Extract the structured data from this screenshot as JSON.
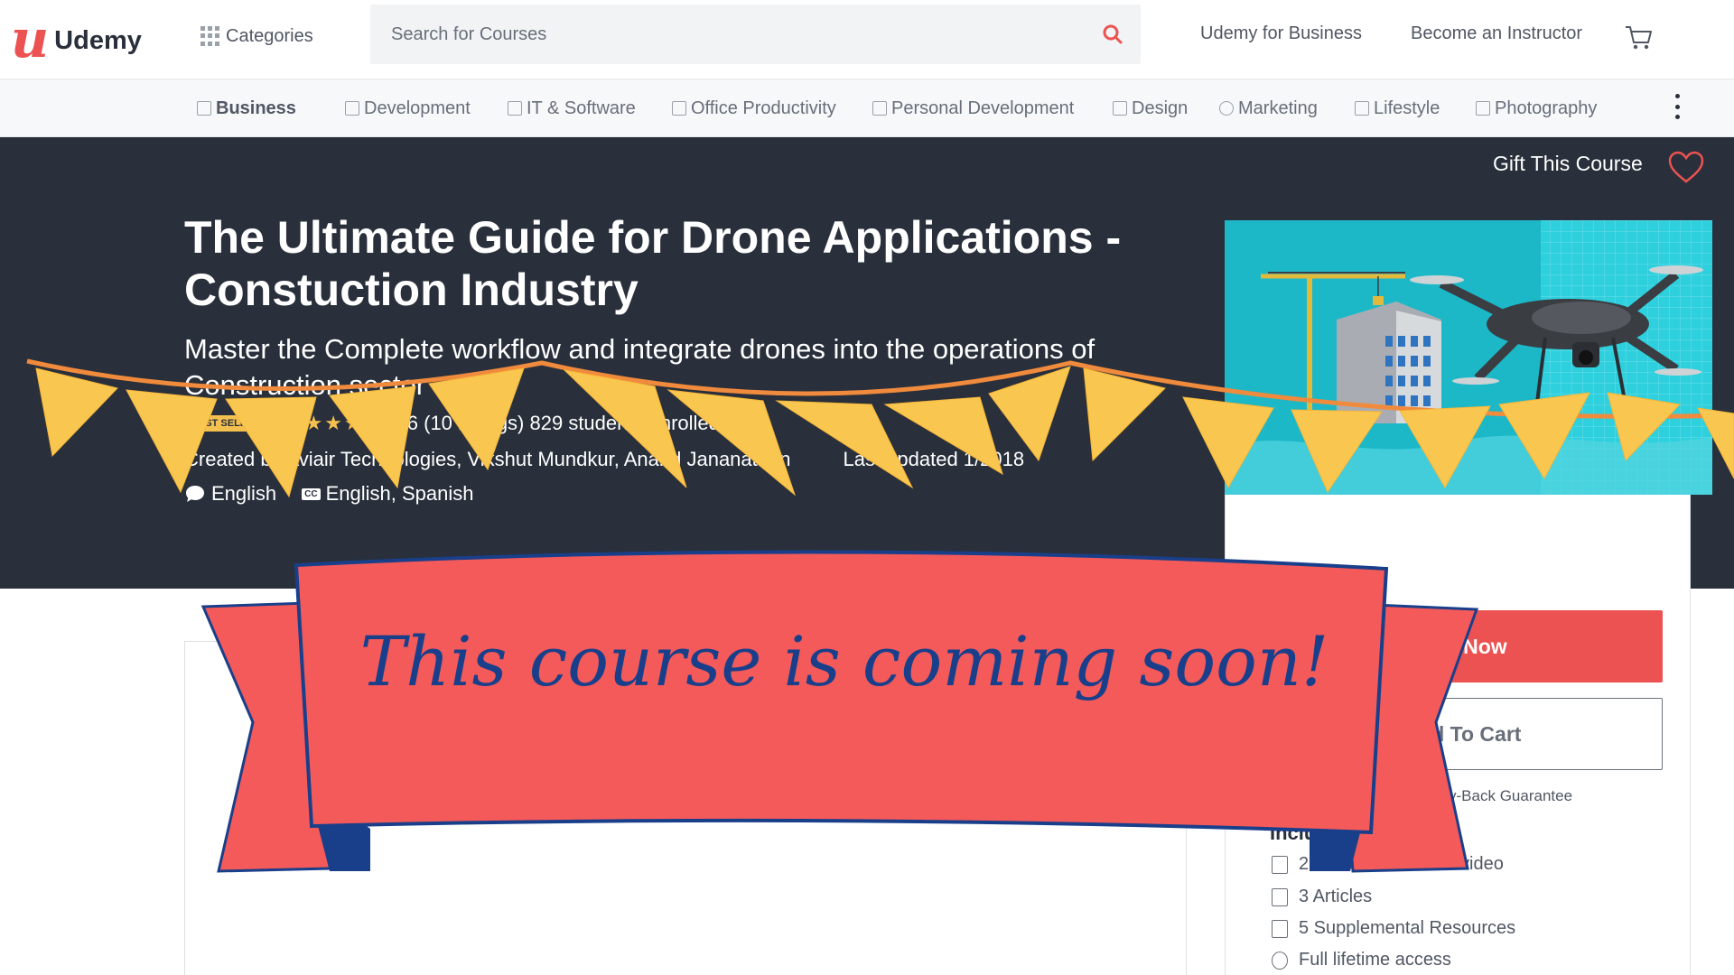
{
  "header": {
    "logo_text": "Udemy",
    "logo_mark": "u",
    "categories_label": "Categories",
    "search_placeholder": "Search for Courses",
    "business_link": "Udemy for Business",
    "instructor_link": "Become an Instructor"
  },
  "catnav": {
    "items": [
      {
        "label": "Business",
        "icon": "chart-icon"
      },
      {
        "label": "Development",
        "icon": "code-icon"
      },
      {
        "label": "IT & Software",
        "icon": "monitor-icon"
      },
      {
        "label": "Office Productivity",
        "icon": "document-icon"
      },
      {
        "label": "Personal Development",
        "icon": "book-icon"
      },
      {
        "label": "Design",
        "icon": "brush-icon"
      },
      {
        "label": "Marketing",
        "icon": "target-icon"
      },
      {
        "label": "Lifestyle",
        "icon": "lifestyle-icon"
      },
      {
        "label": "Photography",
        "icon": "camera-icon"
      }
    ]
  },
  "hero": {
    "gift_label": "Gift This Course",
    "title": "The Ultimate Guide for Drone Applications - Constuction Industry",
    "subtitle": "Master the Complete workflow and integrate drones into the operations of Construction sector",
    "badge": "BEST SELLER",
    "rating_text": "4.6 (10 ratings) 829 students enrolled",
    "created_by": "Created by Aviair Technologies, Vikshut Mundkur, Anand Jananathan",
    "last_updated": "Last updated 1/2018",
    "language": "English",
    "captions": "English, Spanish",
    "cc_label": "CC"
  },
  "sidebar": {
    "buy_label": "Buy Now",
    "cart_label": "Add To Cart",
    "guarantee": "30-Day Money-Back Guarantee",
    "includes_title": "Includes",
    "includes": [
      {
        "label": "2 hours on-demand video",
        "icon": "video-icon"
      },
      {
        "label": "3 Articles",
        "icon": "article-icon"
      },
      {
        "label": "5 Supplemental Resources",
        "icon": "resources-icon"
      },
      {
        "label": "Full lifetime access",
        "icon": "infinity-icon"
      }
    ]
  },
  "overlay": {
    "banner_text": "This course is coming soon!"
  },
  "colors": {
    "brand": "#ec5252",
    "hero_bg": "#29303b",
    "ribbon": "#f45a5a",
    "ribbon_text": "#1a3f8a",
    "bunting": "#f9c74f",
    "bunting_string": "#f08a3c",
    "course_img_bg": "#1cb8c8"
  }
}
